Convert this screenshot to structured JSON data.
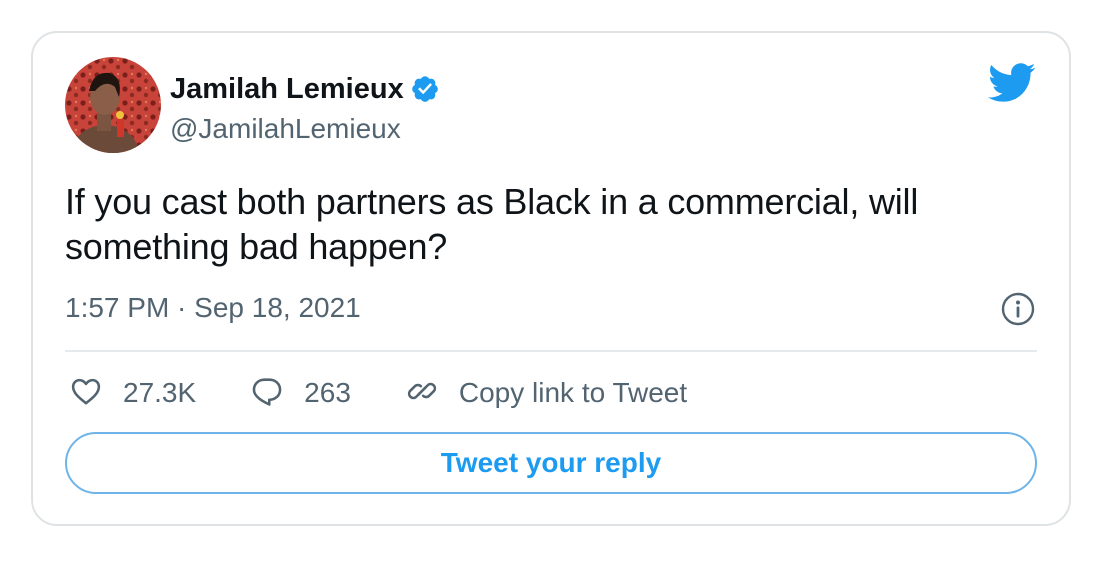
{
  "author": {
    "display_name": "Jamilah Lemieux",
    "handle": "@JamilahLemieux",
    "verified": true
  },
  "tweet": {
    "text": "If you cast both partners as Black in a commercial, will something bad happen?",
    "timestamp": "1:57 PM · Sep 18, 2021"
  },
  "actions": {
    "likes": "27.3K",
    "replies": "263",
    "copy_link": "Copy link to Tweet"
  },
  "reply_button": {
    "label": "Tweet your reply"
  },
  "colors": {
    "accent": "#1d9bf0",
    "text_primary": "#0f1419",
    "text_secondary": "#536471",
    "border": "#dfe3e6"
  },
  "icons": [
    "twitter-bird-icon",
    "verified-badge-icon",
    "info-icon",
    "heart-icon",
    "reply-bubble-icon",
    "link-icon"
  ]
}
